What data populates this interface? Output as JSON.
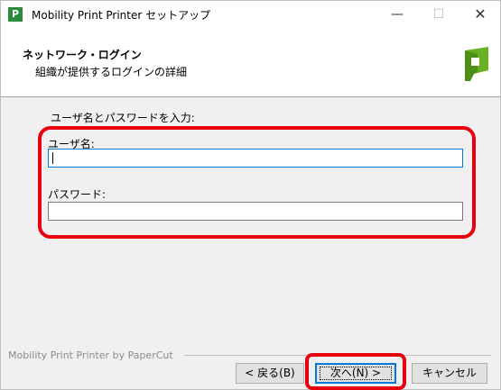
{
  "window": {
    "app_icon_letter": "P",
    "title": "Mobility Print Printer セットアップ",
    "controls": {
      "minimize": "—",
      "maximize": "☐",
      "close": "✕"
    }
  },
  "header": {
    "title": "ネットワーク・ログイン",
    "subtitle": "組織が提供するログインの詳細",
    "logo_icon": "papercut-logo-icon",
    "logo_color": "#6ab023"
  },
  "form": {
    "prompt": "ユーザ名とパスワードを入力:",
    "username_label": "ユーザ名:",
    "username_value": "",
    "password_label": "パスワード:",
    "password_value": ""
  },
  "footer": {
    "brand_text": "Mobility Print Printer by PaperCut",
    "back_button": "< 戻る(B)",
    "next_button": "次へ(N) >",
    "cancel_button": "キャンセル"
  },
  "highlight_color": "#e8000d"
}
